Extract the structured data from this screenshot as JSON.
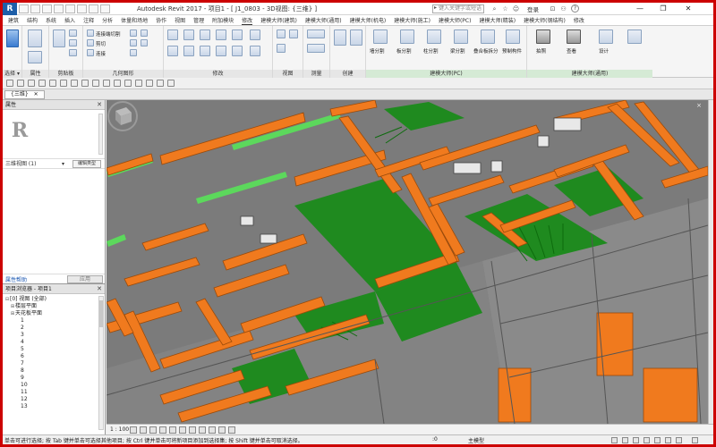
{
  "app": {
    "logo": "R",
    "title": "Autodesk Revit 2017 -  项目1 - [ J1_0803 - 3D视图: {三维} ]",
    "search_placeholder": "键入关键字或短语",
    "user": "登录",
    "window_buttons": [
      "—",
      "❐",
      "✕"
    ]
  },
  "ribbon_tabs": [
    "建筑",
    "结构",
    "系统",
    "插入",
    "注释",
    "分析",
    "体量和场地",
    "协作",
    "视图",
    "管理",
    "附加模块",
    "修改",
    "建模大师(建筑)",
    "建模大师(通用)",
    "建模大师(机电)",
    "建模大师(施工)",
    "建模大师(PC)",
    "建模大师(精装)",
    "建模大师(钢结构)",
    "修改"
  ],
  "ribbon": {
    "groups": [
      {
        "label": "选择 ▾"
      },
      {
        "label": "属性"
      },
      {
        "label": "剪贴板"
      },
      {
        "label": "几何图形"
      },
      {
        "label": "修改"
      },
      {
        "label": "视图"
      },
      {
        "label": "测量"
      },
      {
        "label": "创建"
      },
      {
        "label": "建模大师(PC)"
      },
      {
        "label": "建模大师(通用)"
      }
    ],
    "small_labels": [
      "连接端切割",
      "剪切",
      "连接",
      "拆分",
      "粘贴"
    ],
    "pc_tools": [
      "墙分割",
      "板分割",
      "柱分割",
      "梁分割",
      "叠合板拆分",
      "预制构件"
    ],
    "general_tools": [
      "拍照",
      "查看",
      "设计"
    ]
  },
  "view_tab": {
    "label": "{三维}",
    "close": "✕"
  },
  "properties": {
    "title": "属性",
    "close": "✕",
    "logo_letter": "R",
    "filter_label": "三维视图 (1)",
    "filter_arrow": "▾",
    "edit_type": "编辑类型",
    "help_link": "属性帮助",
    "apply": "应用"
  },
  "browser": {
    "title": "项目浏览器 - 项目1",
    "close": "✕",
    "items": [
      {
        "label": "[0] 视图 (全部)",
        "toggle": "⊟",
        "indent": 0
      },
      {
        "label": "楼层平面",
        "toggle": "⊞",
        "indent": 1
      },
      {
        "label": "天花板平面",
        "toggle": "⊞",
        "indent": 1
      },
      {
        "label": "1",
        "toggle": "",
        "indent": 2
      },
      {
        "label": "2",
        "toggle": "",
        "indent": 2
      },
      {
        "label": "3",
        "toggle": "",
        "indent": 2
      },
      {
        "label": "4",
        "toggle": "",
        "indent": 2
      },
      {
        "label": "5",
        "toggle": "",
        "indent": 2
      },
      {
        "label": "6",
        "toggle": "",
        "indent": 2
      },
      {
        "label": "7",
        "toggle": "",
        "indent": 2
      },
      {
        "label": "8",
        "toggle": "",
        "indent": 2
      },
      {
        "label": "9",
        "toggle": "",
        "indent": 2
      },
      {
        "label": "10",
        "toggle": "",
        "indent": 2
      },
      {
        "label": "11",
        "toggle": "",
        "indent": 2
      },
      {
        "label": "12",
        "toggle": "",
        "indent": 2
      },
      {
        "label": "13",
        "toggle": "",
        "indent": 2
      }
    ]
  },
  "view_control": {
    "scale": "1 : 100"
  },
  "status": {
    "message": "单击可进行选择; 按 Tab 键并单击可选择其他项目; 按 Ctrl 键并单击可将新项目添加到选择集; 按 Shift 键并单击可取消选择。",
    "zero": ":0",
    "model": "主模型"
  },
  "colors": {
    "frame_border": "#cc0000",
    "viewport_bg": "#7a7a7a",
    "wall_orange": "#f07a1e",
    "floor_green": "#1f8a1f",
    "accent_green": "#5cd85c"
  }
}
